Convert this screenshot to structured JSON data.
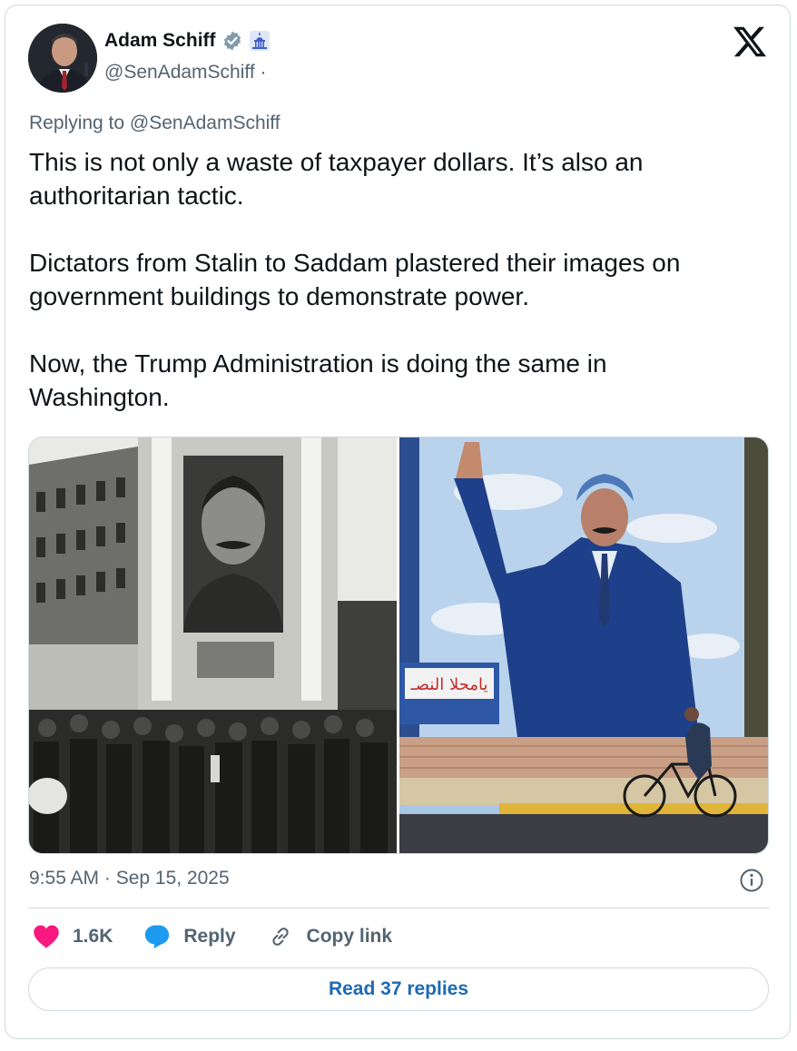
{
  "author": {
    "name": "Adam Schiff",
    "handle": "@SenAdamSchiff ·",
    "verified": true,
    "affiliation_badge": "capitol-building-icon"
  },
  "platform_logo": "x-logo-icon",
  "replying_to": "Replying to @SenAdamSchiff",
  "tweet": {
    "text": "This is not only a waste of taxpayer dollars. It’s also an\nauthoritarian tactic.\n\nDictators from Stalin to Saddam plastered their images on\ngovernment buildings to demonstrate power.\n\nNow, the Trump Administration is doing the same in\nWashington."
  },
  "media": {
    "left_banner_text": "",
    "right_sign_text": "يامحلا النصـ"
  },
  "timestamp": "9:55 AM · Sep 15, 2025",
  "actions": {
    "like_count": "1.6K",
    "reply_label": "Reply",
    "copy_label": "Copy link"
  },
  "read_replies_label": "Read 37 replies",
  "colors": {
    "like": "#f91880",
    "reply": "#1d9bf0",
    "verified": "#829aab",
    "link": "#1d6ab4",
    "muted": "#536471"
  }
}
